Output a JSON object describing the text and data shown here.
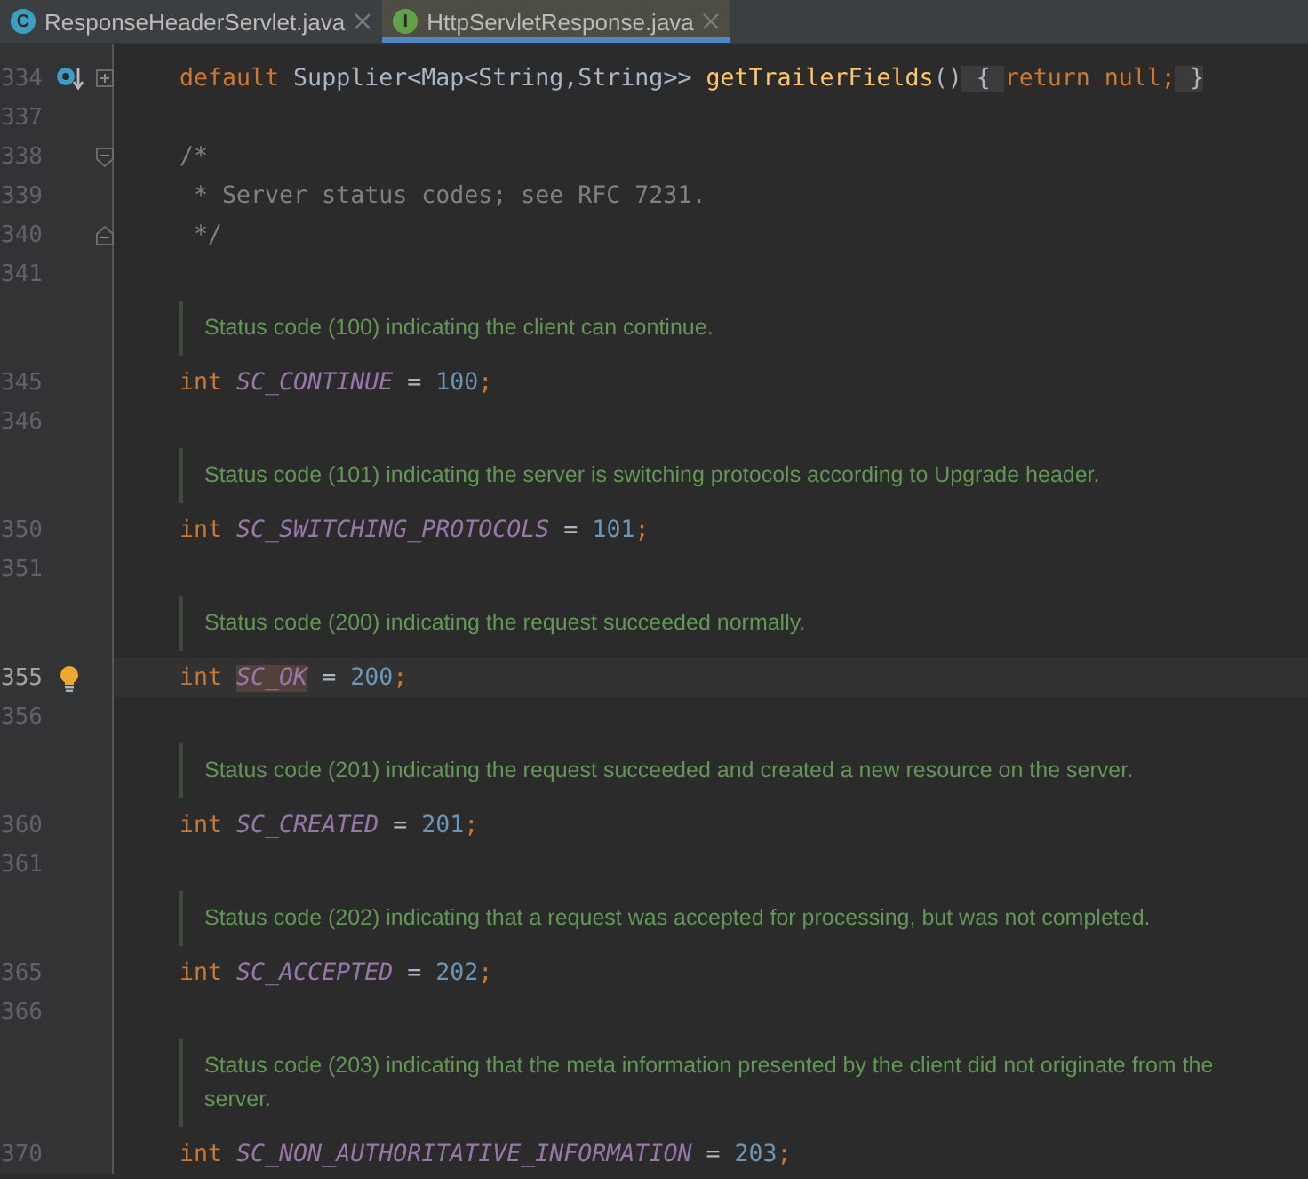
{
  "tabs": [
    {
      "label": "ResponseHeaderServlet.java",
      "icon_letter": "C",
      "kind": "class",
      "selected": false
    },
    {
      "label": "HttpServletResponse.java",
      "icon_letter": "I",
      "kind": "interface",
      "selected": true
    }
  ],
  "lines": [
    {
      "kind": "code",
      "number": "334",
      "current": false,
      "gutter": [
        {
          "kind": "implemented"
        },
        {
          "kind": "expand"
        }
      ],
      "tokens": [
        {
          "text": "default",
          "kind": "keyword"
        },
        {
          "text": " Supplier<Map<String,String>> ",
          "kind": "plain"
        },
        {
          "text": "getTrailerFields",
          "kind": "method"
        },
        {
          "text": "()",
          "kind": "plain"
        },
        {
          "text": " { ",
          "kind": "folded"
        },
        {
          "text": "return null;",
          "kind": "keyword"
        },
        {
          "text": " }",
          "kind": "folded"
        }
      ]
    },
    {
      "kind": "code",
      "number": "337",
      "current": false
    },
    {
      "kind": "code",
      "number": "338",
      "current": false,
      "gutter": [
        {
          "kind": "start"
        }
      ],
      "tokens": [
        {
          "text": "/*",
          "kind": "comment"
        }
      ]
    },
    {
      "kind": "code",
      "number": "339",
      "current": false,
      "tokens": [
        {
          "text": " * Server status codes; see RFC 7231.",
          "kind": "comment"
        }
      ]
    },
    {
      "kind": "code",
      "number": "340",
      "current": false,
      "gutter": [
        {
          "kind": "end"
        }
      ],
      "tokens": [
        {
          "text": " */",
          "kind": "comment"
        }
      ]
    },
    {
      "kind": "code",
      "number": "341",
      "current": false
    },
    {
      "kind": "doc",
      "text": "Status code (100) indicating the client can continue."
    },
    {
      "kind": "code",
      "number": "345",
      "current": false,
      "tokens": [
        {
          "text": "int ",
          "kind": "keyword"
        },
        {
          "text": "SC_CONTINUE",
          "kind": "constant"
        },
        {
          "text": " = ",
          "kind": "plain"
        },
        {
          "text": "100",
          "kind": "number"
        },
        {
          "text": ";",
          "kind": "keyword"
        }
      ]
    },
    {
      "kind": "code",
      "number": "346",
      "current": false
    },
    {
      "kind": "doc",
      "text": "Status code (101) indicating the server is switching protocols according to Upgrade header."
    },
    {
      "kind": "code",
      "number": "350",
      "current": false,
      "tokens": [
        {
          "text": "int ",
          "kind": "keyword"
        },
        {
          "text": "SC_SWITCHING_PROTOCOLS",
          "kind": "constant"
        },
        {
          "text": " = ",
          "kind": "plain"
        },
        {
          "text": "101",
          "kind": "number"
        },
        {
          "text": ";",
          "kind": "keyword"
        }
      ]
    },
    {
      "kind": "code",
      "number": "351",
      "current": false
    },
    {
      "kind": "doc",
      "text": "Status code (200) indicating the request succeeded normally."
    },
    {
      "kind": "code",
      "number": "355",
      "current": true,
      "gutter": [
        {
          "kind": "bulb"
        }
      ],
      "tokens": [
        {
          "text": "int ",
          "kind": "keyword"
        },
        {
          "text": "SC_OK",
          "kind": "highlighted"
        },
        {
          "text": " = ",
          "kind": "plain"
        },
        {
          "text": "200",
          "kind": "number"
        },
        {
          "text": ";",
          "kind": "keyword"
        }
      ]
    },
    {
      "kind": "code",
      "number": "356",
      "current": false
    },
    {
      "kind": "doc",
      "text": "Status code (201) indicating the request succeeded and created a new resource on the server."
    },
    {
      "kind": "code",
      "number": "360",
      "current": false,
      "tokens": [
        {
          "text": "int ",
          "kind": "keyword"
        },
        {
          "text": "SC_CREATED",
          "kind": "constant"
        },
        {
          "text": " = ",
          "kind": "plain"
        },
        {
          "text": "201",
          "kind": "number"
        },
        {
          "text": ";",
          "kind": "keyword"
        }
      ]
    },
    {
      "kind": "code",
      "number": "361",
      "current": false
    },
    {
      "kind": "doc",
      "text": "Status code (202) indicating that a request was accepted for processing, but was not completed."
    },
    {
      "kind": "code",
      "number": "365",
      "current": false,
      "tokens": [
        {
          "text": "int ",
          "kind": "keyword"
        },
        {
          "text": "SC_ACCEPTED",
          "kind": "constant"
        },
        {
          "text": " = ",
          "kind": "plain"
        },
        {
          "text": "202",
          "kind": "number"
        },
        {
          "text": ";",
          "kind": "keyword"
        }
      ]
    },
    {
      "kind": "code",
      "number": "366",
      "current": false
    },
    {
      "kind": "doc",
      "text": "Status code (203) indicating that the meta information presented by the client did not originate from the server."
    },
    {
      "kind": "code",
      "number": "370",
      "current": false,
      "tokens": [
        {
          "text": "int ",
          "kind": "keyword"
        },
        {
          "text": "SC_NON_AUTHORITATIVE_INFORMATION",
          "kind": "constant"
        },
        {
          "text": " = ",
          "kind": "plain"
        },
        {
          "text": "203",
          "kind": "number"
        },
        {
          "text": ";",
          "kind": "keyword"
        }
      ]
    }
  ]
}
